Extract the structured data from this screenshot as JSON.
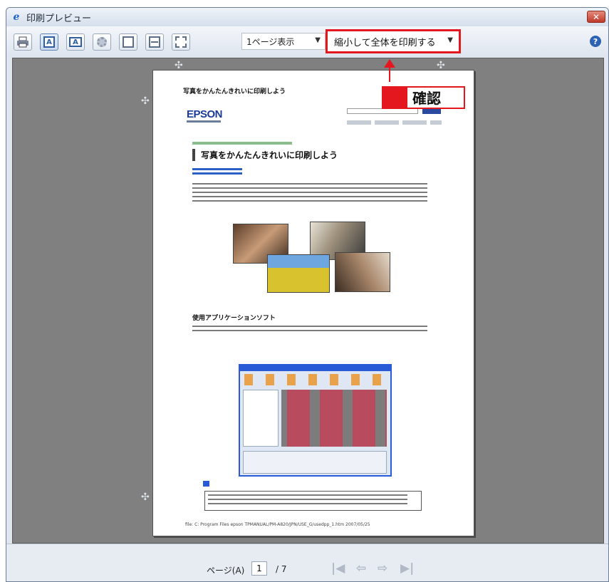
{
  "window": {
    "title": "印刷プレビュー",
    "close_glyph": "✕"
  },
  "toolbar": {
    "view_mode": "1ページ表示",
    "shrink_option": "縮小して全体を印刷する",
    "help_glyph": "?",
    "icons": [
      "printer-icon",
      "portrait-icon",
      "landscape-icon",
      "page-setup-icon",
      "header-footer-off-icon",
      "header-footer-on-icon",
      "full-screen-icon"
    ]
  },
  "callout": {
    "label": "確認",
    "color": "#e4161e"
  },
  "preview_page": {
    "header_text": "写真をかんたんきれいに印刷しよう",
    "brand": "EPSON",
    "title": "写真をかんたんきれいに印刷しよう",
    "section_heading": "使用アプリケーションソフト",
    "footer_text": "file:  C:  Program Files epson  TPMANUAL/PM-A820/JPN/USE_G/usedpp_1.htm          2007/05/25"
  },
  "pager": {
    "label": "ページ(A)",
    "current": "1",
    "total": "/ 7"
  }
}
